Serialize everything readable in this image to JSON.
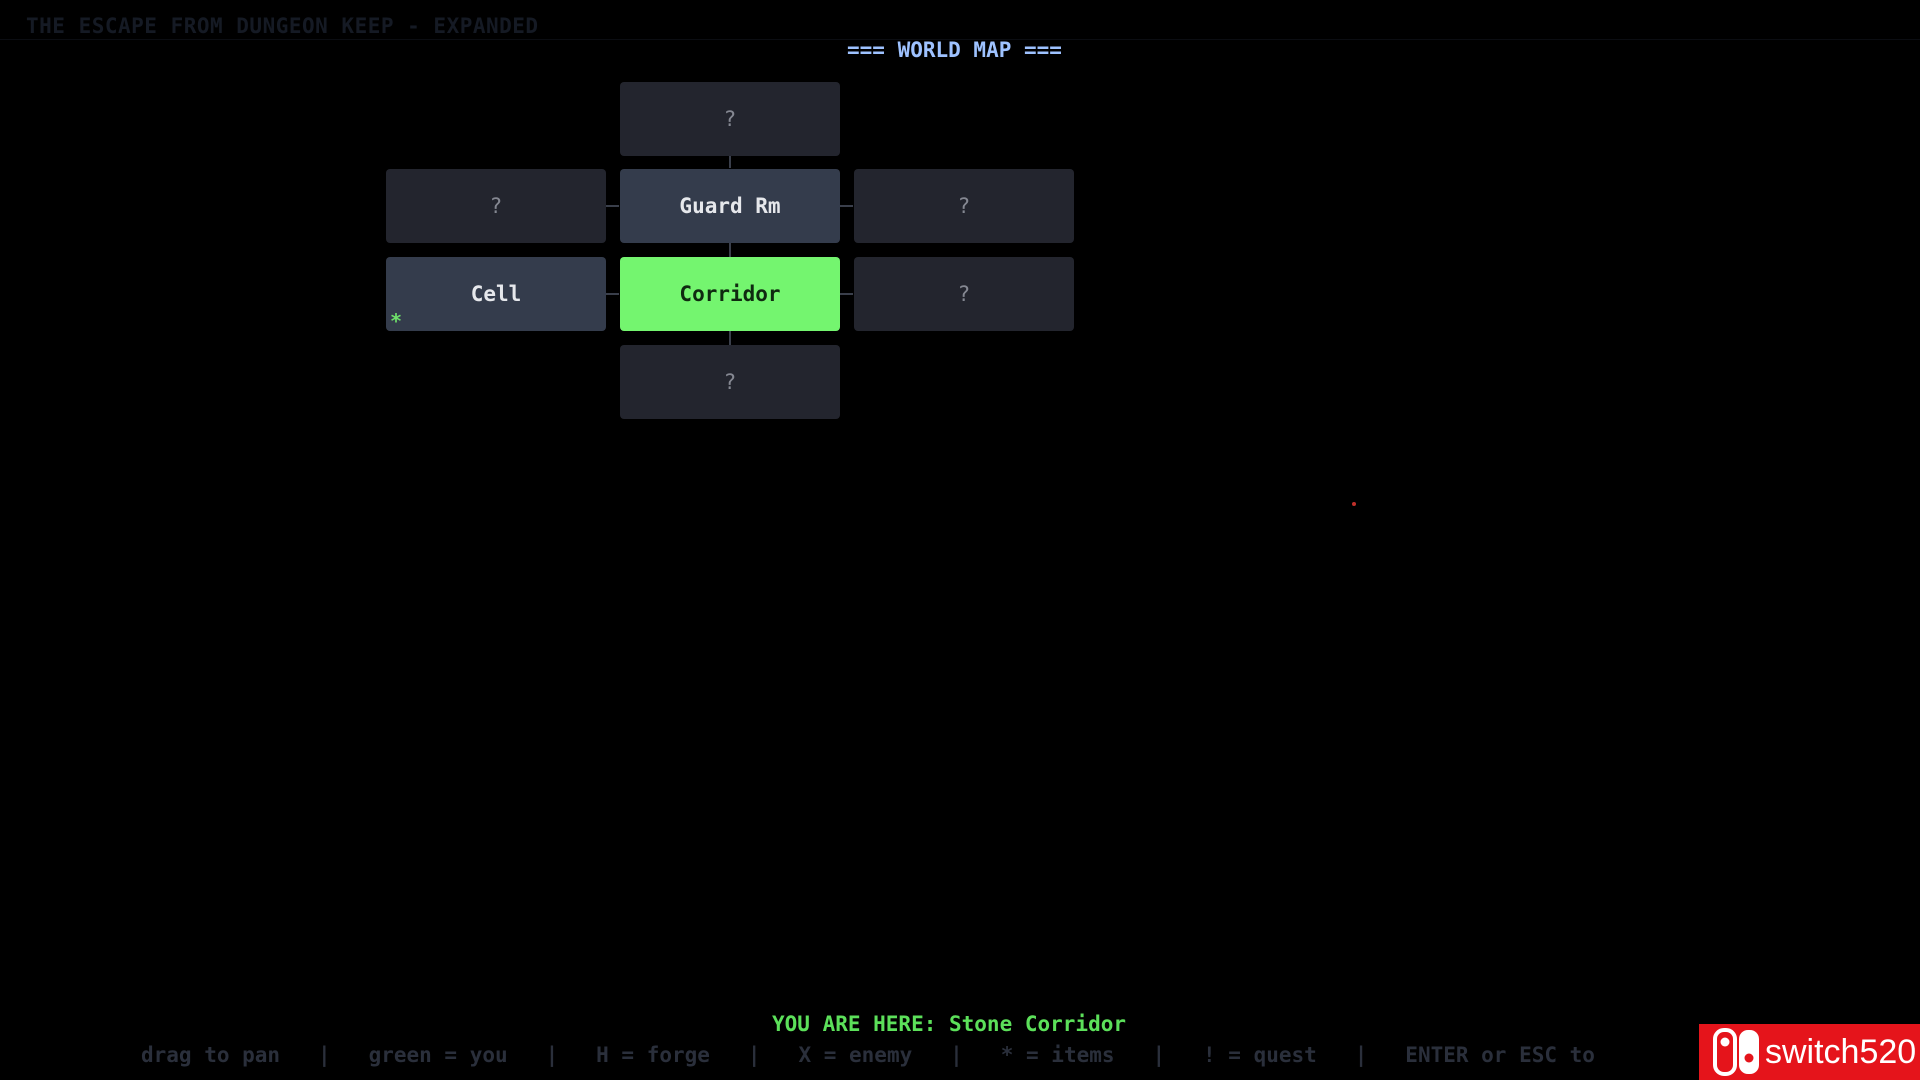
{
  "header": {
    "game_title": "THE ESCAPE FROM DUNGEON KEEP - EXPANDED",
    "map_heading": "=== WORLD MAP ==="
  },
  "map": {
    "rooms": {
      "north": {
        "label": "?",
        "state": "unexplored"
      },
      "guard_room": {
        "label": "Guard Rm",
        "state": "visited"
      },
      "west_of_guard": {
        "label": "?",
        "state": "unexplored"
      },
      "east_of_guard": {
        "label": "?",
        "state": "unexplored"
      },
      "cell": {
        "label": "Cell",
        "state": "visited",
        "marker": "*"
      },
      "corridor": {
        "label": "Corridor",
        "state": "current"
      },
      "east_of_corridor": {
        "label": "?",
        "state": "unexplored"
      },
      "south": {
        "label": "?",
        "state": "unexplored"
      }
    },
    "colors": {
      "current": "#74f56f",
      "visited": "#343c4c",
      "unexplored": "#23252e",
      "heading": "#9ec2ff",
      "location_text": "#5ce05a"
    }
  },
  "footer": {
    "location": "YOU ARE HERE: Stone Corridor",
    "legend": "drag to pan   |   green = you   |   H = forge   |   X = enemy   |   * = items   |   ! = quest   |   ENTER or ESC to"
  },
  "watermark": {
    "text": "switch520",
    "color": "#e5141b"
  }
}
